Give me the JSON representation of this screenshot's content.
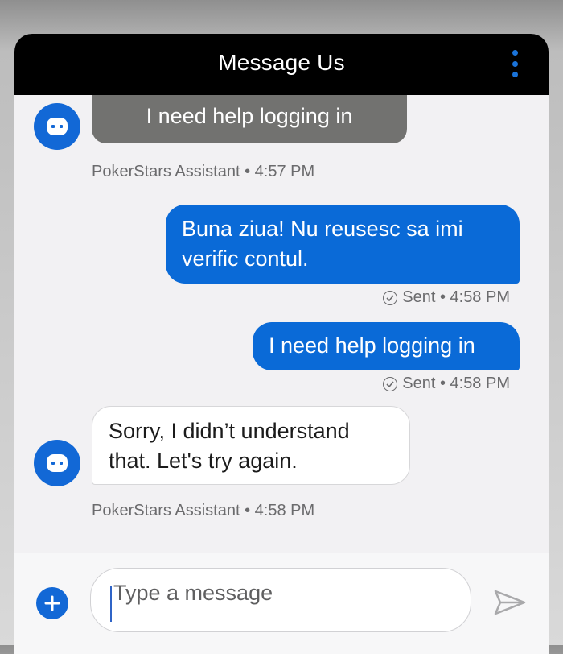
{
  "header": {
    "title": "Message Us",
    "menu_icon": "kebab-vertical-icon",
    "menu_color": "#1a73d9"
  },
  "messages": [
    {
      "sender": "bot",
      "text": "I need help logging in",
      "style": "truncated-grey",
      "meta": "PokerStars Assistant • 4:57 PM"
    },
    {
      "sender": "user",
      "text": "Buna ziua! Nu reusesc sa imi verific contul.",
      "status": "Sent • 4:58 PM"
    },
    {
      "sender": "user",
      "text": "I need help logging in",
      "status": "Sent • 4:58 PM"
    },
    {
      "sender": "bot",
      "text": "Sorry, I didn’t understand that. Let's try again.",
      "meta": "PokerStars Assistant • 4:58 PM"
    }
  ],
  "composer": {
    "placeholder": "Type a message",
    "add_icon": "plus-circle-icon",
    "send_icon": "send-arrow-icon"
  },
  "colors": {
    "accent": "#0a6ad7",
    "bot_avatar": "#1268d6",
    "header_bg": "#000000",
    "chat_bg": "#f2f1f3"
  }
}
